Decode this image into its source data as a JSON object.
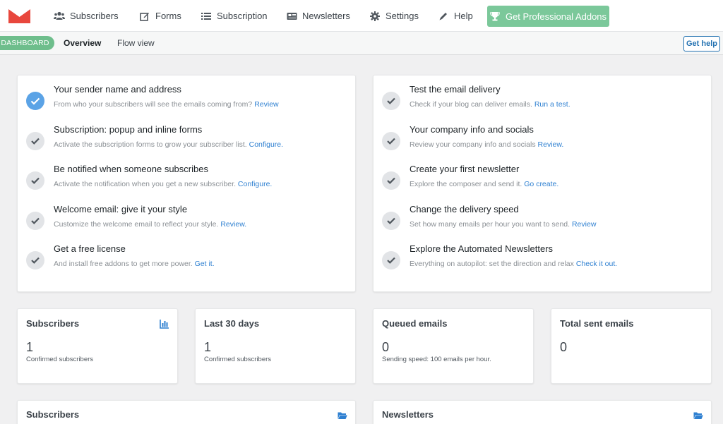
{
  "nav": {
    "items": [
      {
        "label": "Subscribers",
        "icon": "users-icon"
      },
      {
        "label": "Forms",
        "icon": "edit-icon"
      },
      {
        "label": "Subscription",
        "icon": "list-icon"
      },
      {
        "label": "Newsletters",
        "icon": "newspaper-icon"
      },
      {
        "label": "Settings",
        "icon": "gear-icon"
      },
      {
        "label": "Help",
        "icon": "pen-icon"
      }
    ],
    "pro_label": "Get Professional Addons"
  },
  "subbar": {
    "badge": "DASHBOARD",
    "tabs": [
      "Overview",
      "Flow view"
    ],
    "help_label": "Get help"
  },
  "tasks_left": [
    {
      "title": "Your sender name and address",
      "desc": "From who your subscribers will see the emails coming from?",
      "link": "Review",
      "done": true
    },
    {
      "title": "Subscription: popup and inline forms",
      "desc": "Activate the subscription forms to grow your subscriber list.",
      "link": "Configure.",
      "done": false
    },
    {
      "title": "Be notified when someone subscribes",
      "desc": "Activate the notification when you get a new subscriber.",
      "link": "Configure.",
      "done": false
    },
    {
      "title": "Welcome email: give it your style",
      "desc": "Customize the welcome email to reflect your style.",
      "link": "Review.",
      "done": false
    },
    {
      "title": "Get a free license",
      "desc": "And install free addons to get more power.",
      "link": "Get it.",
      "done": false
    }
  ],
  "tasks_right": [
    {
      "title": "Test the email delivery",
      "desc": "Check if your blog can deliver emails.",
      "link": "Run a test.",
      "done": false
    },
    {
      "title": "Your company info and socials",
      "desc": "Review your company info and socials",
      "link": "Review.",
      "done": false
    },
    {
      "title": "Create your first newsletter",
      "desc": "Explore the composer and send it.",
      "link": "Go create.",
      "done": false
    },
    {
      "title": "Change the delivery speed",
      "desc": "Set how many emails per hour you want to send.",
      "link": "Review",
      "done": false
    },
    {
      "title": "Explore the Automated Newsletters",
      "desc": "Everything on autopilot: set the direction and relax",
      "link": "Check it out.",
      "done": false
    }
  ],
  "stats": [
    {
      "title": "Subscribers",
      "value": "1",
      "sub": "Confirmed subscribers",
      "icon": "bar-chart-icon"
    },
    {
      "title": "Last 30 days",
      "value": "1",
      "sub": "Confirmed subscribers"
    },
    {
      "title": "Queued emails",
      "value": "0",
      "sub": "Sending speed: 100 emails per hour."
    },
    {
      "title": "Total sent emails",
      "value": "0",
      "sub": ""
    }
  ],
  "bottom": [
    {
      "title": "Subscribers",
      "icon": "folder-open-icon"
    },
    {
      "title": "Newsletters",
      "icon": "folder-open-icon"
    }
  ],
  "colors": {
    "accent": "#2f80d1",
    "brand": "#e8473d",
    "pro": "#7bc89a",
    "done": "#5ba3e6"
  }
}
